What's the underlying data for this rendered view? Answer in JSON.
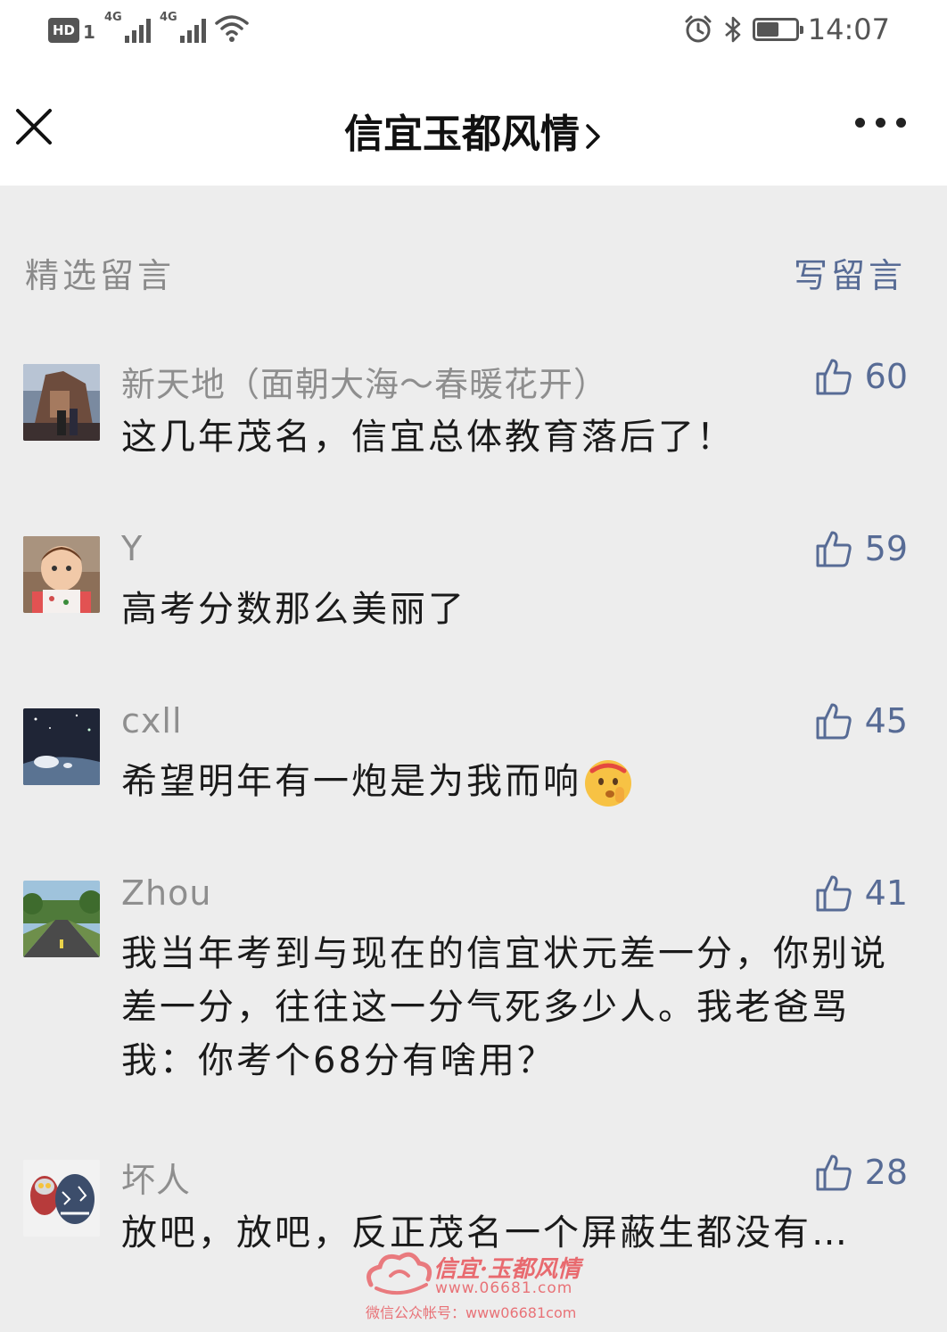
{
  "status_bar": {
    "hd_label": "HD",
    "hd_sub": "1",
    "network_1": "4G",
    "network_2": "4G",
    "time": "14:07",
    "battery_level": 0.55
  },
  "nav": {
    "title": "信宜玉都风情"
  },
  "section": {
    "title": "精选留言",
    "write_label": "写留言"
  },
  "comments": [
    {
      "nickname": "新天地（面朝大海～春暖花开）",
      "content": "这几年茂名，信宜总体教育落后了！",
      "likes": "60"
    },
    {
      "nickname": "Y",
      "content": "高考分数那么美丽了",
      "likes": "59"
    },
    {
      "nickname": "cxll",
      "content": "希望明年有一炮是为我而响",
      "likes": "45"
    },
    {
      "nickname": "Zhou",
      "content": "我当年考到与现在的信宜状元差一分，你别说差一分，往往这一分气死多少人。我老爸骂我：你考个68分有啥用？",
      "likes": "41"
    },
    {
      "nickname": "坏人",
      "content": "放吧，放吧，反正茂名一个屏蔽生都没有…",
      "likes": "28"
    }
  ],
  "watermark": {
    "title": "信宜·玉都风情",
    "url": "www.06681.com",
    "account": "微信公众帐号：www06681com"
  },
  "colors": {
    "link": "#576b95",
    "background": "#ededed",
    "watermark": "#e8545a"
  }
}
